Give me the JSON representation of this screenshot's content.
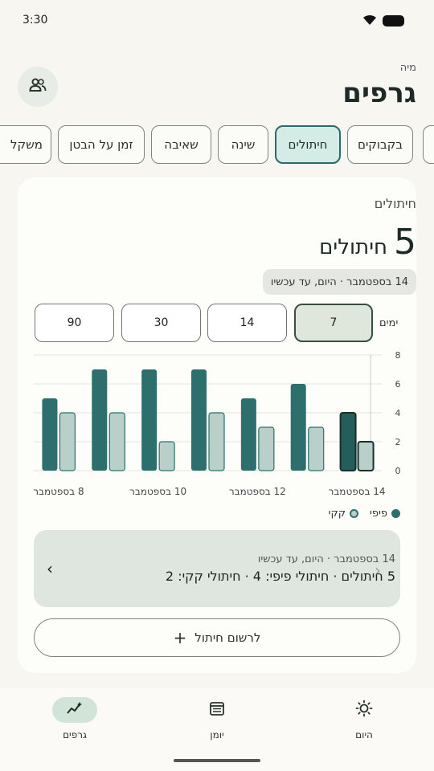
{
  "status": {
    "time": "3:30"
  },
  "header": {
    "owner": "מיה",
    "title": "גרפים"
  },
  "tabs": [
    {
      "label": "בקבוקים",
      "active": false
    },
    {
      "label": "חיתולים",
      "active": true
    },
    {
      "label": "שינה",
      "active": false
    },
    {
      "label": "שאיבה",
      "active": false
    },
    {
      "label": "זמן על הבטן",
      "active": false
    },
    {
      "label": "משקל",
      "active": false
    }
  ],
  "card": {
    "label": "חיתולים",
    "value": "5",
    "unit": "חיתולים",
    "date_range": "14 בספטמבר · היום, עד עכשיו",
    "range_label": "ימים",
    "ranges": [
      "7",
      "14",
      "30",
      "90"
    ],
    "active_range": "7"
  },
  "chart_data": {
    "type": "bar",
    "categories": [
      "8 בספטמבר",
      "9 בספטמבר",
      "10 בספטמבר",
      "11 בספטמבר",
      "12 בספטמבר",
      "13 בספטמבר",
      "14 בספטמבר"
    ],
    "x_tick_labels": [
      "8 בספטמבר",
      "10 בספטמבר",
      "12 בספטמבר",
      "14 בספטמבר"
    ],
    "series": [
      {
        "name": "פיפי",
        "color": "#2d6f6c",
        "values": [
          5,
          7,
          7,
          7,
          5,
          6,
          4
        ]
      },
      {
        "name": "קקי",
        "color": "#b9cfca",
        "values": [
          4,
          4,
          2,
          4,
          3,
          3,
          2
        ]
      }
    ],
    "ylim": [
      0,
      8
    ],
    "y_ticks": [
      "0",
      "2",
      "4",
      "6",
      "8"
    ],
    "grid": true,
    "legend": "bottom-right"
  },
  "summary": {
    "date": "14 בספטמבר · היום, עד עכשיו",
    "text": "5 חיתולים · חיתולי פיפי: 4 · חיתולי קקי: 2"
  },
  "add_button": {
    "label": "לרשום חיתול",
    "icon": "plus-icon"
  },
  "nav": [
    {
      "label": "גרפים",
      "icon": "chart-icon",
      "active": true
    },
    {
      "label": "יומן",
      "icon": "calendar-icon",
      "active": false
    },
    {
      "label": "היום",
      "icon": "sun-icon",
      "active": false
    }
  ]
}
